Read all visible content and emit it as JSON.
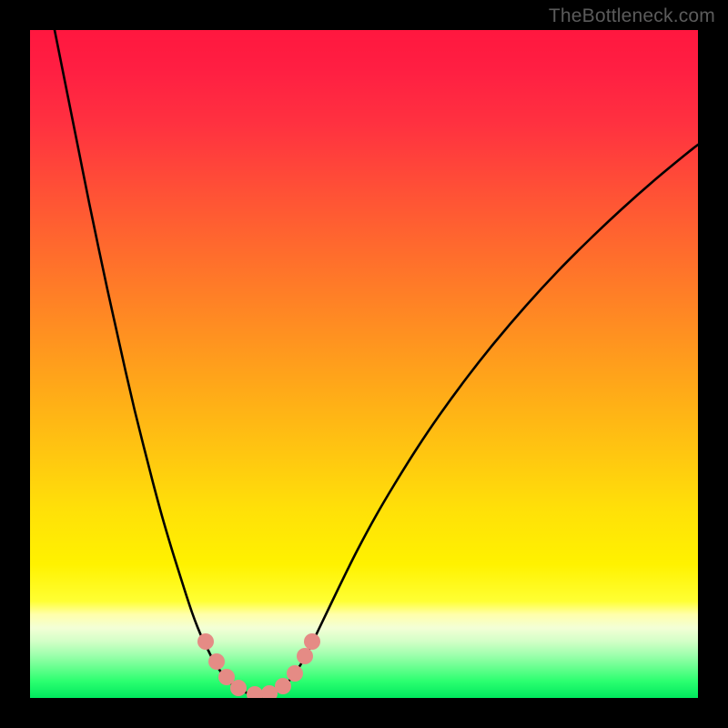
{
  "watermark": "TheBottleneck.com",
  "gradient_stops": [
    {
      "offset": 0.0,
      "color": "#ff173f"
    },
    {
      "offset": 0.06,
      "color": "#ff1f42"
    },
    {
      "offset": 0.14,
      "color": "#ff3140"
    },
    {
      "offset": 0.24,
      "color": "#ff5036"
    },
    {
      "offset": 0.34,
      "color": "#ff6e2c"
    },
    {
      "offset": 0.44,
      "color": "#ff8c22"
    },
    {
      "offset": 0.54,
      "color": "#ffaa18"
    },
    {
      "offset": 0.64,
      "color": "#ffc810"
    },
    {
      "offset": 0.72,
      "color": "#ffe108"
    },
    {
      "offset": 0.8,
      "color": "#fff200"
    },
    {
      "offset": 0.855,
      "color": "#ffff33"
    },
    {
      "offset": 0.875,
      "color": "#ffffaa"
    },
    {
      "offset": 0.895,
      "color": "#f3ffd6"
    },
    {
      "offset": 0.915,
      "color": "#d3ffc7"
    },
    {
      "offset": 0.935,
      "color": "#a0ffae"
    },
    {
      "offset": 0.955,
      "color": "#66ff8e"
    },
    {
      "offset": 0.975,
      "color": "#2bff70"
    },
    {
      "offset": 1.0,
      "color": "#00e85e"
    }
  ],
  "curve_color": "#000000",
  "curve_width": 2.6,
  "marker_color": "#e58b85",
  "marker_radius": 9,
  "chart_data": {
    "type": "line",
    "title": "",
    "xlabel": "",
    "ylabel": "",
    "xlim": [
      0,
      734
    ],
    "ylim_note": "y increases downward in pixel space; visual floor at y≈734, top at y=0",
    "series": [
      {
        "name": "bottleneck-curve",
        "points": [
          [
            27,
            0
          ],
          [
            35,
            40
          ],
          [
            45,
            90
          ],
          [
            55,
            140
          ],
          [
            65,
            190
          ],
          [
            75,
            238
          ],
          [
            85,
            285
          ],
          [
            95,
            330
          ],
          [
            105,
            375
          ],
          [
            115,
            418
          ],
          [
            125,
            458
          ],
          [
            135,
            497
          ],
          [
            145,
            534
          ],
          [
            155,
            568
          ],
          [
            165,
            600
          ],
          [
            172,
            622
          ],
          [
            178,
            640
          ],
          [
            184,
            656
          ],
          [
            190,
            670
          ],
          [
            196,
            682
          ],
          [
            201,
            692
          ],
          [
            206,
            700
          ],
          [
            211,
            707
          ],
          [
            216,
            713
          ],
          [
            221,
            718
          ],
          [
            226,
            722
          ],
          [
            231,
            725
          ],
          [
            236,
            727.5
          ],
          [
            241,
            729.3
          ],
          [
            246,
            730.5
          ],
          [
            252,
            731
          ],
          [
            258,
            730.5
          ],
          [
            263,
            729.3
          ],
          [
            268,
            727.5
          ],
          [
            273,
            725
          ],
          [
            278,
            721.5
          ],
          [
            283,
            717
          ],
          [
            288,
            711
          ],
          [
            293,
            704
          ],
          [
            300,
            693
          ],
          [
            308,
            678
          ],
          [
            318,
            657
          ],
          [
            330,
            632
          ],
          [
            345,
            601
          ],
          [
            360,
            571
          ],
          [
            380,
            534
          ],
          [
            400,
            500
          ],
          [
            425,
            460
          ],
          [
            450,
            423
          ],
          [
            480,
            382
          ],
          [
            510,
            344
          ],
          [
            545,
            303
          ],
          [
            580,
            265
          ],
          [
            615,
            230
          ],
          [
            650,
            197
          ],
          [
            685,
            166
          ],
          [
            720,
            137
          ],
          [
            734,
            126
          ]
        ]
      }
    ],
    "markers": [
      {
        "x": 193,
        "y": 672
      },
      {
        "x": 205,
        "y": 694
      },
      {
        "x": 216,
        "y": 711
      },
      {
        "x": 229,
        "y": 723
      },
      {
        "x": 247,
        "y": 730
      },
      {
        "x": 263,
        "y": 729
      },
      {
        "x": 278,
        "y": 721
      },
      {
        "x": 291,
        "y": 707
      },
      {
        "x": 302,
        "y": 688
      },
      {
        "x": 310,
        "y": 672
      }
    ]
  }
}
